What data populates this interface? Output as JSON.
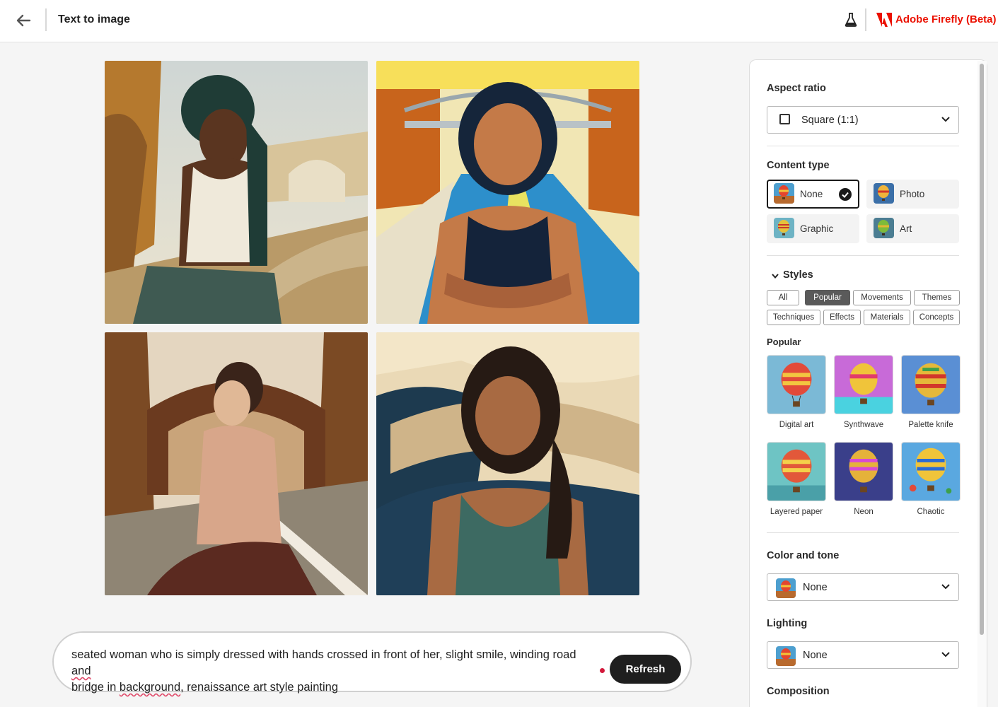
{
  "header": {
    "back_icon": "arrow-left-icon",
    "title": "Text to image",
    "labs_icon": "flask-icon",
    "brand_icon": "adobe-logo-icon",
    "brand_name": "Adobe Firefly (Beta)",
    "brand_color": "#eb1000"
  },
  "gallery": {
    "images": [
      {
        "id": "image-1"
      },
      {
        "id": "image-2"
      },
      {
        "id": "image-3"
      },
      {
        "id": "image-4"
      }
    ]
  },
  "prompt": {
    "text_part1": "seated woman who is simply dressed with hands crossed in front of her, slight smile, winding road ",
    "word_flag1": "and",
    "text_part2": "bridge in ",
    "word_flag2": "background",
    "text_part3": ", renaissance art style painting",
    "refresh_label": "Refresh"
  },
  "panel": {
    "aspect_ratio": {
      "title": "Aspect ratio",
      "selected": "Square (1:1)"
    },
    "content_type": {
      "title": "Content type",
      "options": [
        {
          "label": "None",
          "selected": true
        },
        {
          "label": "Photo",
          "selected": false
        },
        {
          "label": "Graphic",
          "selected": false
        },
        {
          "label": "Art",
          "selected": false
        }
      ]
    },
    "styles": {
      "title": "Styles",
      "chips": [
        "All",
        "Popular",
        "Movements",
        "Themes",
        "Techniques",
        "Effects",
        "Materials",
        "Concepts"
      ],
      "active_chip": "Popular",
      "subheading": "Popular",
      "tiles": [
        "Digital art",
        "Synthwave",
        "Palette knife",
        "Layered paper",
        "Neon",
        "Chaotic"
      ]
    },
    "color_tone": {
      "title": "Color and tone",
      "selected": "None"
    },
    "lighting": {
      "title": "Lighting",
      "selected": "None"
    },
    "composition": {
      "title": "Composition"
    }
  }
}
